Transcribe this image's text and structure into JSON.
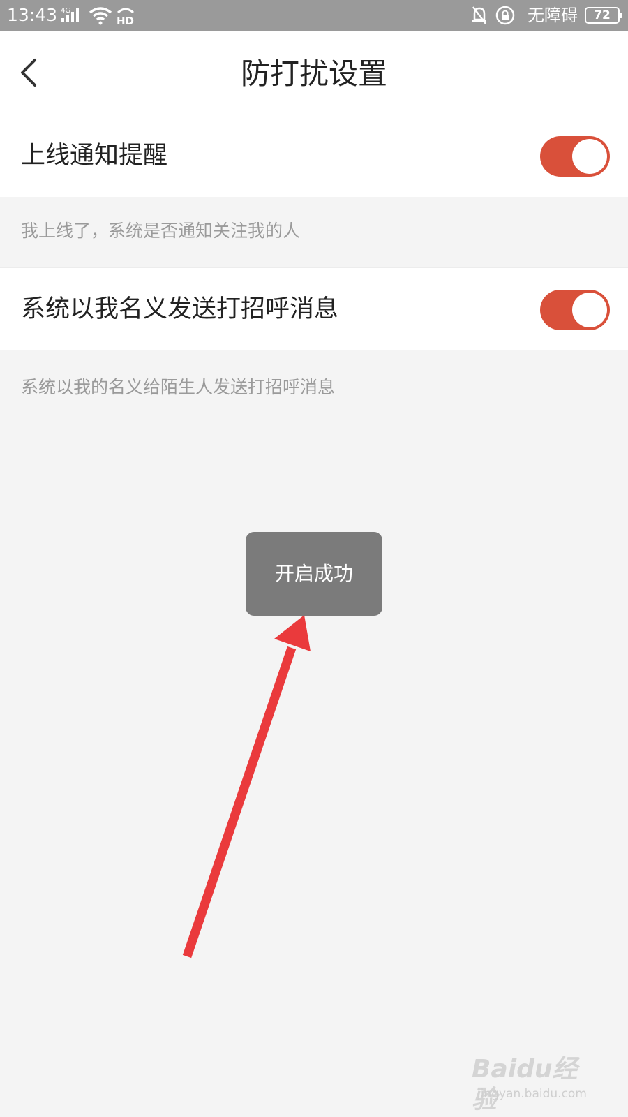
{
  "status_bar": {
    "time": "13:43",
    "network_label": "4G",
    "accessibility_label": "无障碍",
    "battery_level": "72",
    "icons": [
      "signal-icon",
      "wifi-icon",
      "hd-icon",
      "bell-muted-icon",
      "lock-icon",
      "battery-icon"
    ]
  },
  "header": {
    "title": "防打扰设置",
    "back_icon": "chevron-left-icon"
  },
  "settings": [
    {
      "label": "上线通知提醒",
      "description": "我上线了，系统是否通知关注我的人",
      "enabled": true
    },
    {
      "label": "系统以我名义发送打招呼消息",
      "description": "系统以我的名义给陌生人发送打招呼消息",
      "enabled": true
    }
  ],
  "toast": {
    "message": "开启成功"
  },
  "watermark": {
    "brand": "Baidu经验",
    "url": "jingyan.baidu.com"
  },
  "colors": {
    "accent": "#d9503a",
    "background": "#f4f4f4",
    "status_bar": "#9a9a9a",
    "toast": "#7b7b7b",
    "annotation_arrow": "#ea3a3c"
  }
}
